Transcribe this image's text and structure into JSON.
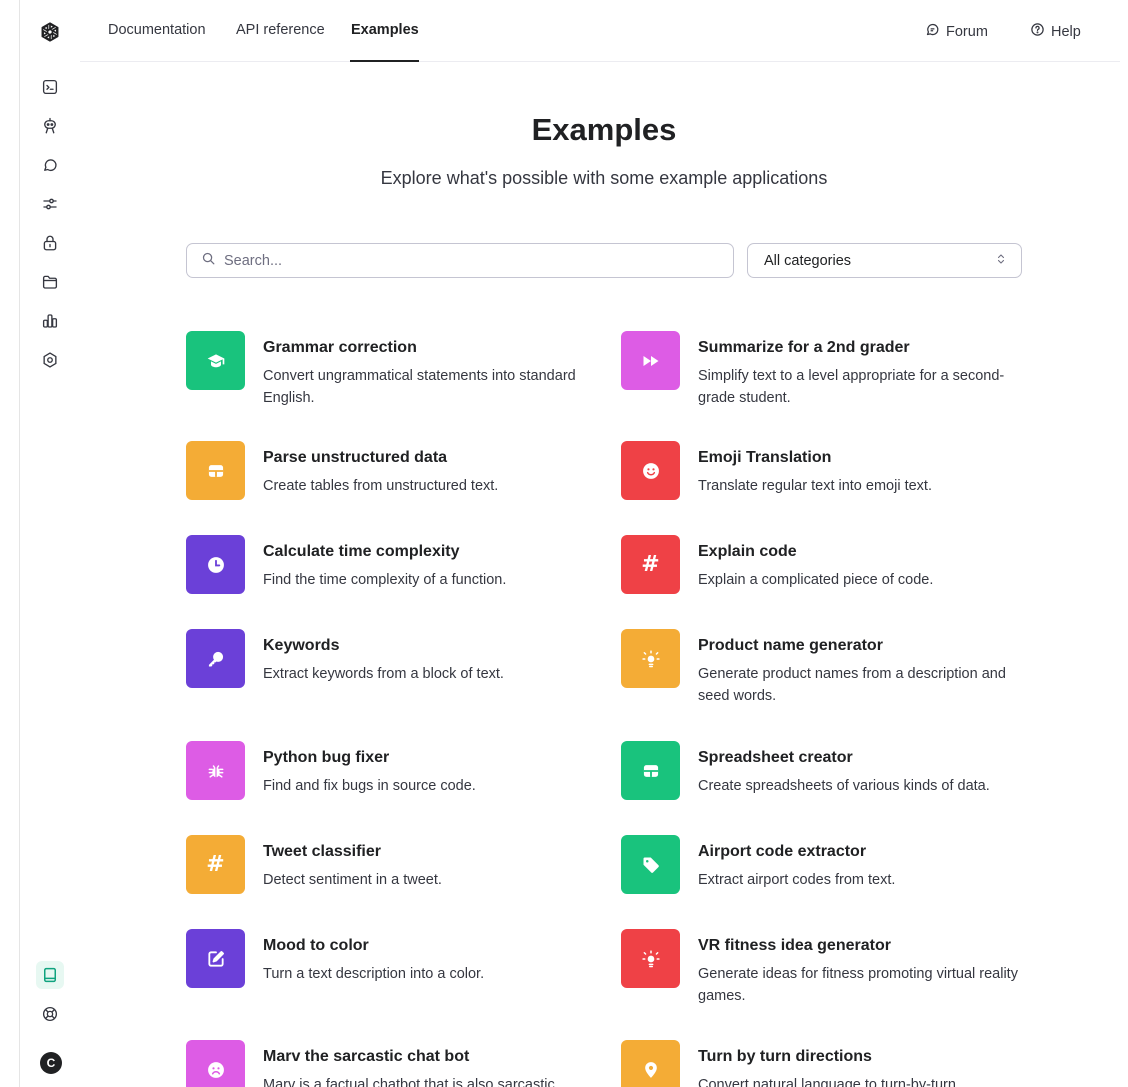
{
  "nav": {
    "links": [
      "Documentation",
      "API reference",
      "Examples"
    ],
    "forum": "Forum",
    "help": "Help"
  },
  "header": {
    "title": "Examples",
    "subtitle": "Explore what's possible with some example applications"
  },
  "search": {
    "placeholder": "Search..."
  },
  "filter": {
    "selected": "All categories"
  },
  "user": {
    "initial": "C"
  },
  "examples": [
    {
      "title": "Grammar correction",
      "desc": "Convert ungrammatical statements into standard English.",
      "color": "#19c37d",
      "icon": "graduation-cap-icon"
    },
    {
      "title": "Summarize for a 2nd grader",
      "desc": "Simplify text to a level appropriate for a second-grade student.",
      "color": "#dd5ce5",
      "icon": "fast-forward-icon"
    },
    {
      "title": "Parse unstructured data",
      "desc": "Create tables from unstructured text.",
      "color": "#f4ac36",
      "icon": "table-icon"
    },
    {
      "title": "Emoji Translation",
      "desc": "Translate regular text into emoji text.",
      "color": "#ef4146",
      "icon": "smile-icon"
    },
    {
      "title": "Calculate time complexity",
      "desc": "Find the time complexity of a function.",
      "color": "#6b40d8",
      "icon": "clock-icon"
    },
    {
      "title": "Explain code",
      "desc": "Explain a complicated piece of code.",
      "color": "#ef4146",
      "icon": "hash-icon"
    },
    {
      "title": "Keywords",
      "desc": "Extract keywords from a block of text.",
      "color": "#6b40d8",
      "icon": "key-icon"
    },
    {
      "title": "Product name generator",
      "desc": "Generate product names from a description and seed words.",
      "color": "#f4ac36",
      "icon": "lightbulb-icon"
    },
    {
      "title": "Python bug fixer",
      "desc": "Find and fix bugs in source code.",
      "color": "#dd5ce5",
      "icon": "bug-icon"
    },
    {
      "title": "Spreadsheet creator",
      "desc": "Create spreadsheets of various kinds of data.",
      "color": "#19c37d",
      "icon": "table-icon"
    },
    {
      "title": "Tweet classifier",
      "desc": "Detect sentiment in a tweet.",
      "color": "#f4ac36",
      "icon": "hash-icon"
    },
    {
      "title": "Airport code extractor",
      "desc": "Extract airport codes from text.",
      "color": "#19c37d",
      "icon": "tag-icon"
    },
    {
      "title": "Mood to color",
      "desc": "Turn a text description into a color.",
      "color": "#6b40d8",
      "icon": "edit-icon"
    },
    {
      "title": "VR fitness idea generator",
      "desc": "Generate ideas for fitness promoting virtual reality games.",
      "color": "#ef4146",
      "icon": "lightbulb-icon"
    },
    {
      "title": "Marv the sarcastic chat bot",
      "desc": "Marv is a factual chatbot that is also sarcastic.",
      "color": "#dd5ce5",
      "icon": "frown-icon"
    },
    {
      "title": "Turn by turn directions",
      "desc": "Convert natural language to turn-by-turn directions.",
      "color": "#f4ac36",
      "icon": "map-pin-icon"
    }
  ]
}
